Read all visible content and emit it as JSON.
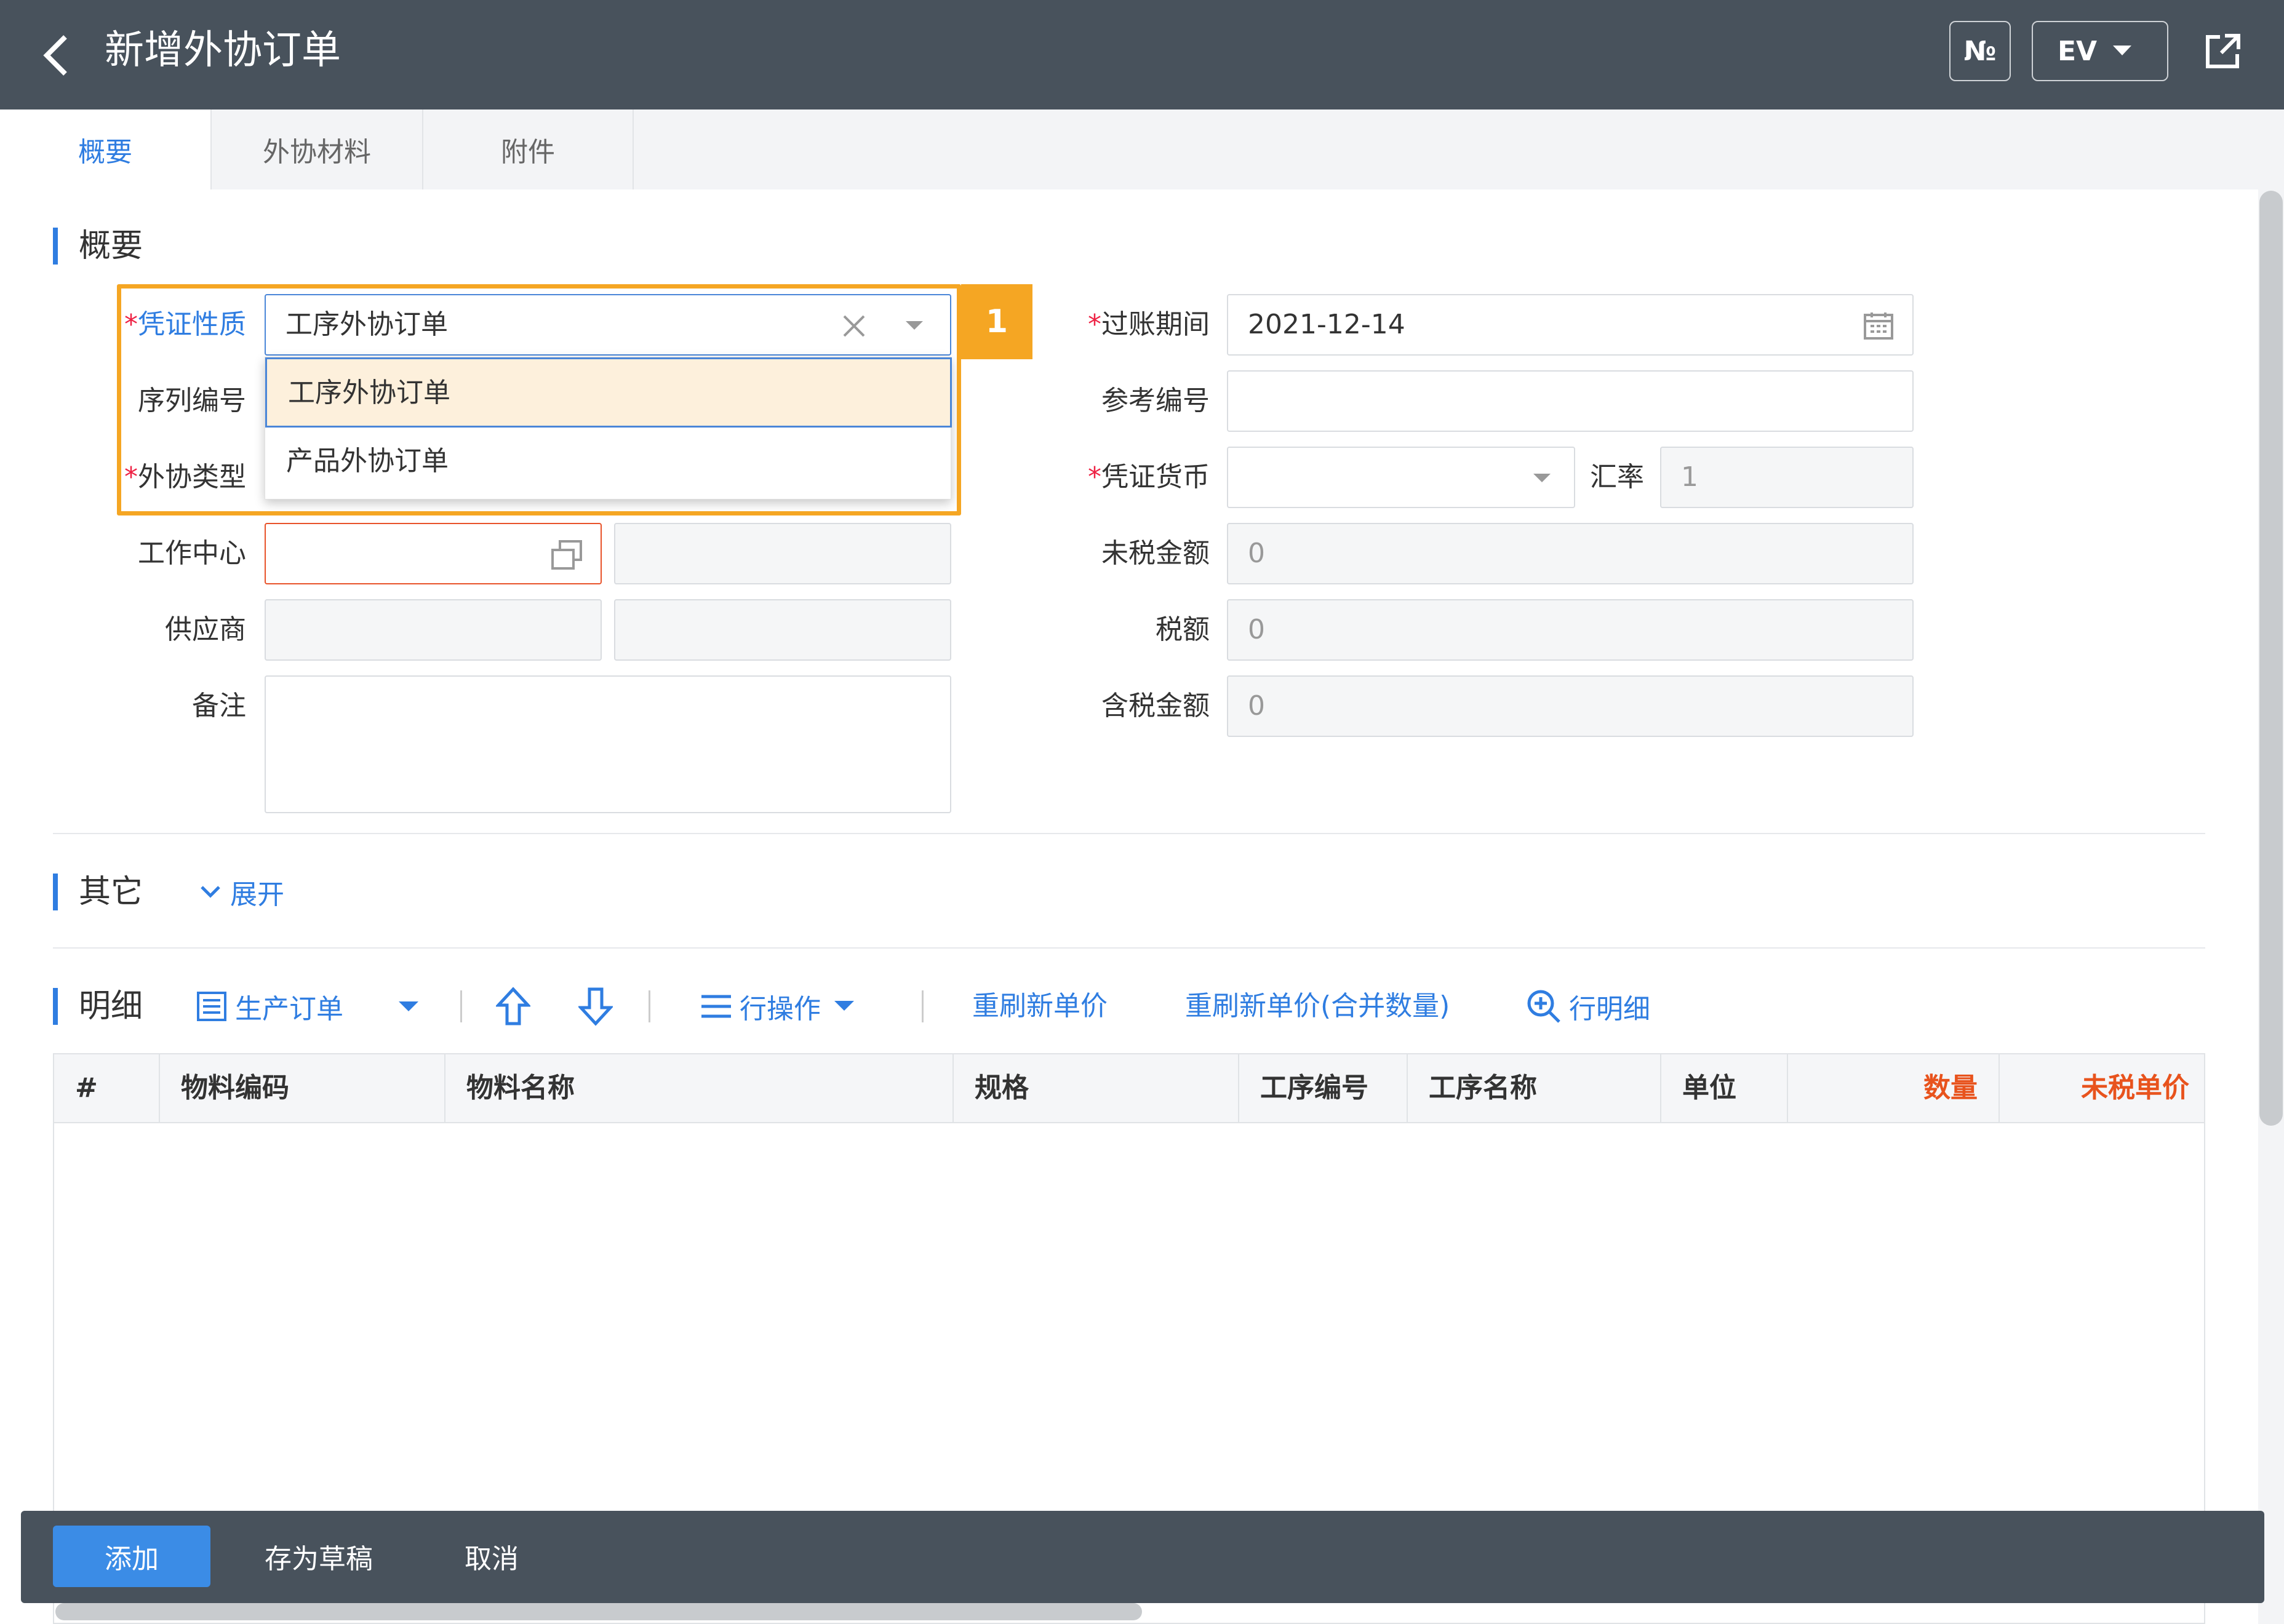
{
  "header": {
    "title": "新增外协订单",
    "no_label": "№",
    "lang_label": "EV"
  },
  "tabs": [
    {
      "label": "概要",
      "active": true
    },
    {
      "label": "外协材料",
      "active": false
    },
    {
      "label": "附件",
      "active": false
    }
  ],
  "summary_section": {
    "title": "概要"
  },
  "form": {
    "voucher_nature": {
      "label": "凭证性质",
      "value": "工序外协订单",
      "required": true
    },
    "serial_no": {
      "label": "序列编号"
    },
    "outsource_type": {
      "label": "外协类型",
      "required": true
    },
    "work_center": {
      "label": "工作中心",
      "value": ""
    },
    "supplier": {
      "label": "供应商",
      "value": ""
    },
    "remark": {
      "label": "备注",
      "value": ""
    },
    "posting_period": {
      "label": "过账期间",
      "value": "2021-12-14",
      "required": true
    },
    "reference_no": {
      "label": "参考编号",
      "value": ""
    },
    "currency": {
      "label": "凭证货币",
      "value": "",
      "required": true
    },
    "exchange_rate": {
      "label": "汇率",
      "value": "1"
    },
    "pretax_amount": {
      "label": "未税金额",
      "value": "0"
    },
    "tax_amount": {
      "label": "税额",
      "value": "0"
    },
    "taxed_amount": {
      "label": "含税金额",
      "value": "0"
    }
  },
  "dropdown": {
    "options": [
      "工序外协订单",
      "产品外协订单"
    ],
    "selected_index": 0
  },
  "annotation_badge": "1",
  "other_section": {
    "title": "其它",
    "expand_label": "展开"
  },
  "detail_section": {
    "title": "明细",
    "toolbar": {
      "production_order": "生产订单",
      "row_ops": "行操作",
      "refresh_price": "重刷新单价",
      "refresh_price_merge": "重刷新单价(合并数量)",
      "row_detail": "行明细"
    },
    "columns": [
      "#",
      "物料编码",
      "物料名称",
      "规格",
      "工序编号",
      "工序名称",
      "单位",
      "数量",
      "未税单价"
    ]
  },
  "footer": {
    "add": "添加",
    "save_draft": "存为草稿",
    "cancel": "取消"
  },
  "colors": {
    "header_bg": "#48525c",
    "accent": "#2f7de1",
    "highlight": "#f5a623",
    "required_col": "#e8531d"
  }
}
